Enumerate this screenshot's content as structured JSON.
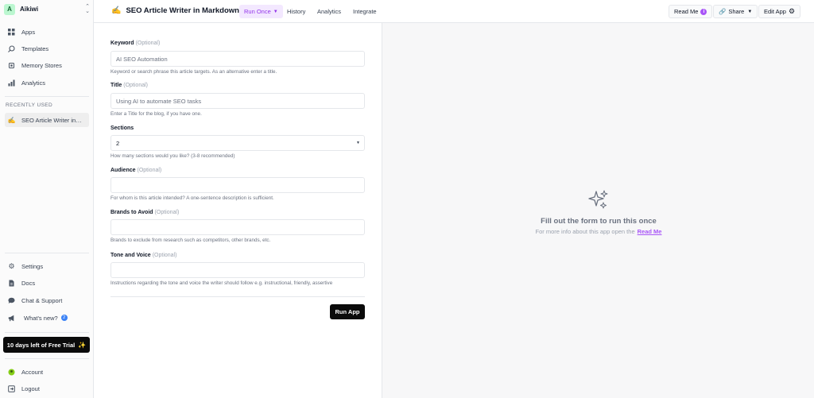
{
  "workspace": {
    "initial": "A",
    "name": "Aikiwi"
  },
  "sidebar": {
    "nav": [
      {
        "label": "Apps",
        "icon": "apps-icon"
      },
      {
        "label": "Templates",
        "icon": "search-icon"
      },
      {
        "label": "Memory Stores",
        "icon": "memory-icon"
      },
      {
        "label": "Analytics",
        "icon": "bar-chart-icon"
      }
    ],
    "recently_used_label": "RECENTLY USED",
    "recent": [
      {
        "label": "SEO Article Writer in…",
        "icon": "writing-hand-icon"
      }
    ],
    "bottom": [
      {
        "label": "Settings",
        "icon": "gear-icon"
      },
      {
        "label": "Docs",
        "icon": "doc-icon"
      },
      {
        "label": "Chat & Support",
        "icon": "chat-icon"
      },
      {
        "label": "What's new?",
        "icon": "megaphone-icon",
        "badge": "2"
      }
    ],
    "trial": "10 days left of Free Trial",
    "account": [
      {
        "label": "Account",
        "icon": "account-icon"
      },
      {
        "label": "Logout",
        "icon": "logout-icon"
      }
    ]
  },
  "topbar": {
    "app_title": "SEO Article Writer in Markdown",
    "tabs": [
      "Run Once",
      "History",
      "Analytics",
      "Integrate"
    ],
    "read_me": "Read Me",
    "share": "Share",
    "edit_app": "Edit App"
  },
  "form": {
    "optional_tag": "(Optional)",
    "fields": [
      {
        "label": "Keyword",
        "optional": true,
        "value": "AI SEO Automation",
        "help": "Keyword or search phrase this article targets. As an alternative enter a title."
      },
      {
        "label": "Title",
        "optional": true,
        "value": "Using AI to automate SEO tasks",
        "help": "Enter a Title for the blog, if you have one."
      },
      {
        "label": "Sections",
        "optional": false,
        "value": "2",
        "help": "How many sections would you like? (3-8 recommended)"
      },
      {
        "label": "Audience",
        "optional": true,
        "value": "",
        "help": "For whom is this article intended? A one-sentence description is sufficient."
      },
      {
        "label": "Brands to Avoid",
        "optional": true,
        "value": "",
        "help": "Brands to exclude from research such as competitors, other brands, etc."
      },
      {
        "label": "Tone and Voice",
        "optional": true,
        "value": "",
        "help": "Instructions regarding the tone and voice the writer should follow e.g. instructional, friendly, assertive"
      }
    ],
    "run_button": "Run App"
  },
  "empty_state": {
    "title": "Fill out the form to run this once",
    "subtitle": "For more info about this app open the",
    "link": "Read Me"
  },
  "colors": {
    "accent": "#a855f7",
    "primary_button": "#0b0b0b"
  }
}
